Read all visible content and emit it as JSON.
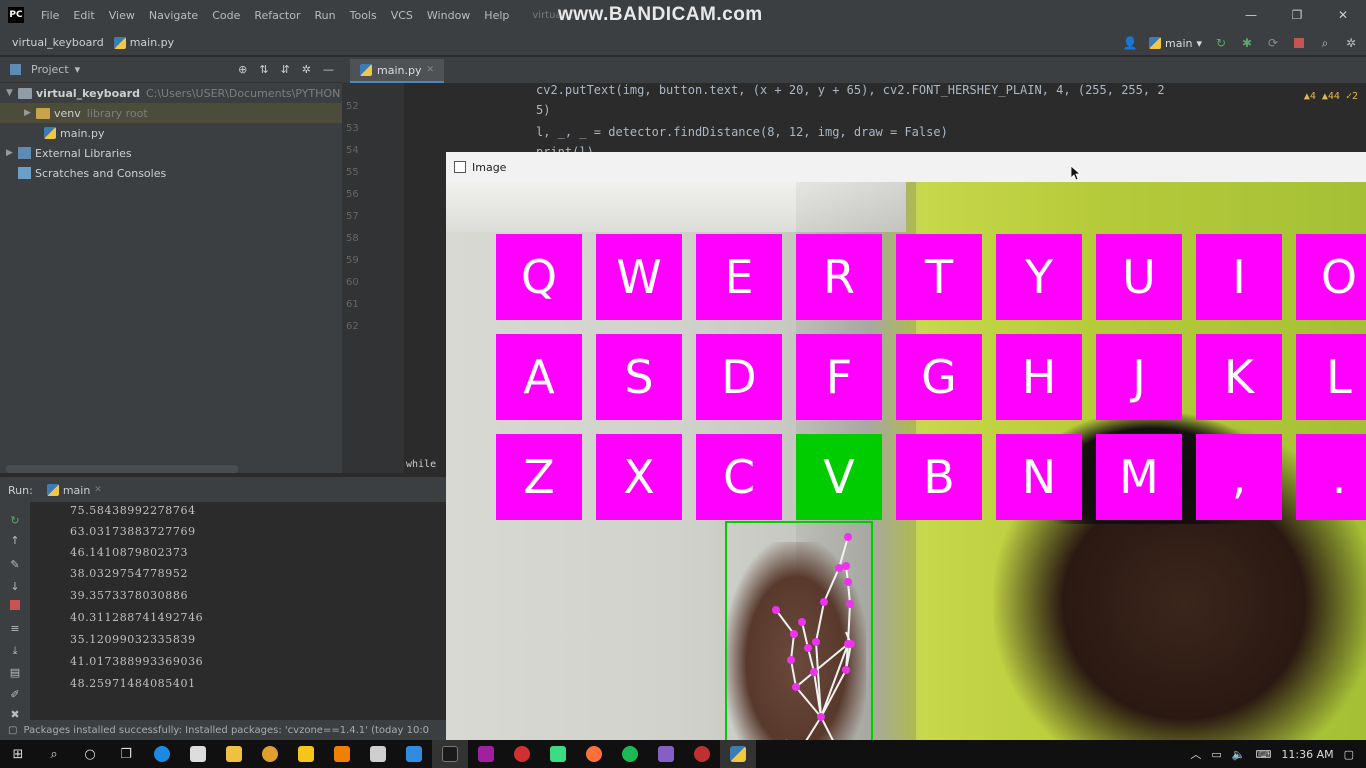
{
  "menu": [
    "File",
    "Edit",
    "View",
    "Navigate",
    "Code",
    "Refactor",
    "Run",
    "Tools",
    "VCS",
    "Window",
    "Help"
  ],
  "title_faded": "virtual...",
  "watermark": "www.BANDICAM.com",
  "window_controls": [
    "—",
    "❐",
    "✕"
  ],
  "nav": {
    "project": "virtual_keyboard",
    "file": "main.py",
    "run_config": "main"
  },
  "project_panel": {
    "header": "Project",
    "tree": [
      {
        "label": "virtual_keyboard",
        "detail": "C:\\Users\\USER\\Documents\\PYTHON"
      },
      {
        "label": "venv",
        "detail": "library root"
      },
      {
        "label": "main.py",
        "detail": ""
      },
      {
        "label": "External Libraries",
        "detail": ""
      },
      {
        "label": "Scratches and Consoles",
        "detail": ""
      }
    ]
  },
  "editor": {
    "tab": "main.py",
    "line_numbers": [
      "52",
      "53",
      "54",
      "55",
      "56",
      "57",
      "58",
      "59",
      "60",
      "61",
      "62"
    ],
    "code": [
      "cv2.putText(img, button.text, (x + 20, y + 65), cv2.FONT_HERSHEY_PLAIN, 4, (255, 255, 2",
      "            5)",
      "l, _, _ = detector.findDistance(8, 12, img, draw = False)",
      "print(l)"
    ],
    "inspection": "▲4  ▲44  ✓2",
    "fragment": "while"
  },
  "run_panel": {
    "label": "Run:",
    "config": "main",
    "console": [
      "75.58438992278764",
      "63.03173883727769",
      "46.1410879802373",
      "38.0329754778952",
      "39.3573378030886",
      "40.311288741492746",
      "35.12099032335839",
      "41.017388993369036",
      "48.25971484085401"
    ]
  },
  "status": "Packages installed successfully: Installed packages: 'cvzone==1.4.1' (today 10:0",
  "image_window": {
    "title": "Image",
    "keys": [
      [
        "Q",
        "W",
        "E",
        "R",
        "T",
        "Y",
        "U",
        "I",
        "O"
      ],
      [
        "A",
        "S",
        "D",
        "F",
        "G",
        "H",
        "J",
        "K",
        "L"
      ],
      [
        "Z",
        "X",
        "C",
        "V",
        "B",
        "N",
        "M",
        ",",
        "."
      ]
    ],
    "active_key": "V",
    "key_color": "#ff00ff",
    "active_color": "#00cc00"
  },
  "taskbar": {
    "clock": "11:36 AM"
  }
}
